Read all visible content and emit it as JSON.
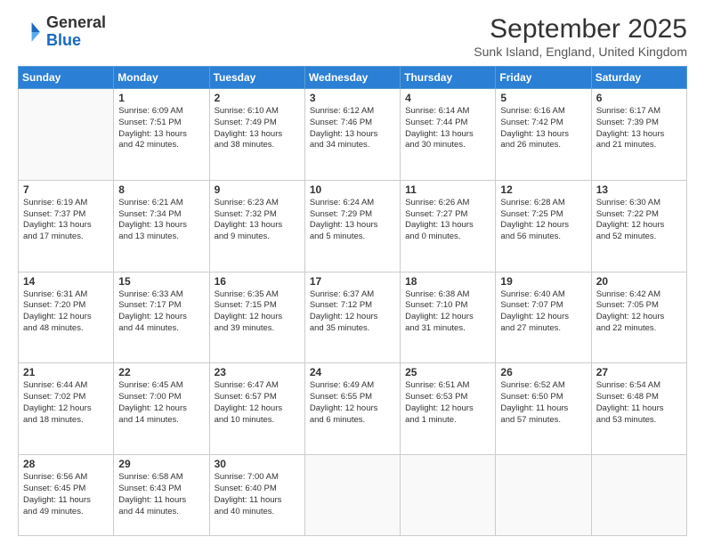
{
  "header": {
    "logo_general": "General",
    "logo_blue": "Blue",
    "month_title": "September 2025",
    "subtitle": "Sunk Island, England, United Kingdom"
  },
  "days_of_week": [
    "Sunday",
    "Monday",
    "Tuesday",
    "Wednesday",
    "Thursday",
    "Friday",
    "Saturday"
  ],
  "weeks": [
    [
      {
        "day": "",
        "content": ""
      },
      {
        "day": "1",
        "content": "Sunrise: 6:09 AM\nSunset: 7:51 PM\nDaylight: 13 hours\nand 42 minutes."
      },
      {
        "day": "2",
        "content": "Sunrise: 6:10 AM\nSunset: 7:49 PM\nDaylight: 13 hours\nand 38 minutes."
      },
      {
        "day": "3",
        "content": "Sunrise: 6:12 AM\nSunset: 7:46 PM\nDaylight: 13 hours\nand 34 minutes."
      },
      {
        "day": "4",
        "content": "Sunrise: 6:14 AM\nSunset: 7:44 PM\nDaylight: 13 hours\nand 30 minutes."
      },
      {
        "day": "5",
        "content": "Sunrise: 6:16 AM\nSunset: 7:42 PM\nDaylight: 13 hours\nand 26 minutes."
      },
      {
        "day": "6",
        "content": "Sunrise: 6:17 AM\nSunset: 7:39 PM\nDaylight: 13 hours\nand 21 minutes."
      }
    ],
    [
      {
        "day": "7",
        "content": "Sunrise: 6:19 AM\nSunset: 7:37 PM\nDaylight: 13 hours\nand 17 minutes."
      },
      {
        "day": "8",
        "content": "Sunrise: 6:21 AM\nSunset: 7:34 PM\nDaylight: 13 hours\nand 13 minutes."
      },
      {
        "day": "9",
        "content": "Sunrise: 6:23 AM\nSunset: 7:32 PM\nDaylight: 13 hours\nand 9 minutes."
      },
      {
        "day": "10",
        "content": "Sunrise: 6:24 AM\nSunset: 7:29 PM\nDaylight: 13 hours\nand 5 minutes."
      },
      {
        "day": "11",
        "content": "Sunrise: 6:26 AM\nSunset: 7:27 PM\nDaylight: 13 hours\nand 0 minutes."
      },
      {
        "day": "12",
        "content": "Sunrise: 6:28 AM\nSunset: 7:25 PM\nDaylight: 12 hours\nand 56 minutes."
      },
      {
        "day": "13",
        "content": "Sunrise: 6:30 AM\nSunset: 7:22 PM\nDaylight: 12 hours\nand 52 minutes."
      }
    ],
    [
      {
        "day": "14",
        "content": "Sunrise: 6:31 AM\nSunset: 7:20 PM\nDaylight: 12 hours\nand 48 minutes."
      },
      {
        "day": "15",
        "content": "Sunrise: 6:33 AM\nSunset: 7:17 PM\nDaylight: 12 hours\nand 44 minutes."
      },
      {
        "day": "16",
        "content": "Sunrise: 6:35 AM\nSunset: 7:15 PM\nDaylight: 12 hours\nand 39 minutes."
      },
      {
        "day": "17",
        "content": "Sunrise: 6:37 AM\nSunset: 7:12 PM\nDaylight: 12 hours\nand 35 minutes."
      },
      {
        "day": "18",
        "content": "Sunrise: 6:38 AM\nSunset: 7:10 PM\nDaylight: 12 hours\nand 31 minutes."
      },
      {
        "day": "19",
        "content": "Sunrise: 6:40 AM\nSunset: 7:07 PM\nDaylight: 12 hours\nand 27 minutes."
      },
      {
        "day": "20",
        "content": "Sunrise: 6:42 AM\nSunset: 7:05 PM\nDaylight: 12 hours\nand 22 minutes."
      }
    ],
    [
      {
        "day": "21",
        "content": "Sunrise: 6:44 AM\nSunset: 7:02 PM\nDaylight: 12 hours\nand 18 minutes."
      },
      {
        "day": "22",
        "content": "Sunrise: 6:45 AM\nSunset: 7:00 PM\nDaylight: 12 hours\nand 14 minutes."
      },
      {
        "day": "23",
        "content": "Sunrise: 6:47 AM\nSunset: 6:57 PM\nDaylight: 12 hours\nand 10 minutes."
      },
      {
        "day": "24",
        "content": "Sunrise: 6:49 AM\nSunset: 6:55 PM\nDaylight: 12 hours\nand 6 minutes."
      },
      {
        "day": "25",
        "content": "Sunrise: 6:51 AM\nSunset: 6:53 PM\nDaylight: 12 hours\nand 1 minute."
      },
      {
        "day": "26",
        "content": "Sunrise: 6:52 AM\nSunset: 6:50 PM\nDaylight: 11 hours\nand 57 minutes."
      },
      {
        "day": "27",
        "content": "Sunrise: 6:54 AM\nSunset: 6:48 PM\nDaylight: 11 hours\nand 53 minutes."
      }
    ],
    [
      {
        "day": "28",
        "content": "Sunrise: 6:56 AM\nSunset: 6:45 PM\nDaylight: 11 hours\nand 49 minutes."
      },
      {
        "day": "29",
        "content": "Sunrise: 6:58 AM\nSunset: 6:43 PM\nDaylight: 11 hours\nand 44 minutes."
      },
      {
        "day": "30",
        "content": "Sunrise: 7:00 AM\nSunset: 6:40 PM\nDaylight: 11 hours\nand 40 minutes."
      },
      {
        "day": "",
        "content": ""
      },
      {
        "day": "",
        "content": ""
      },
      {
        "day": "",
        "content": ""
      },
      {
        "day": "",
        "content": ""
      }
    ]
  ]
}
